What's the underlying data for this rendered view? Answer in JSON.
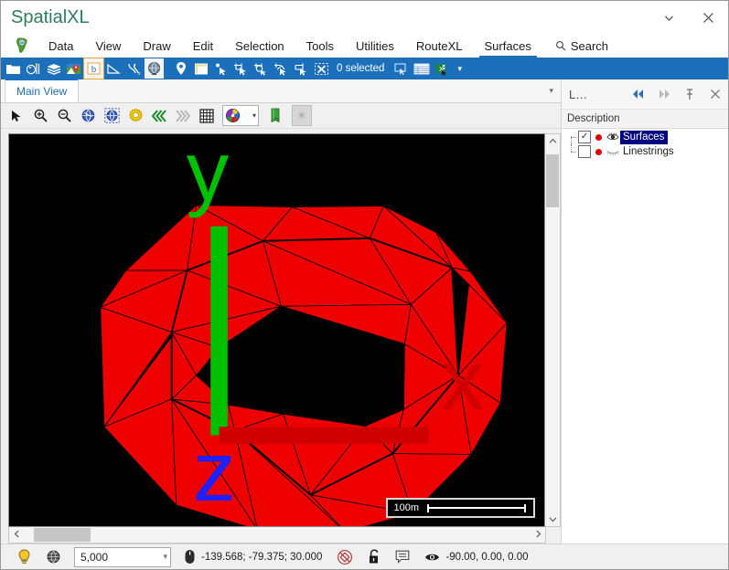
{
  "window": {
    "title": "SpatialXL",
    "minimize_label": "▾",
    "close_label": "✕"
  },
  "menu": {
    "logo_icon": "africa-logo-icon",
    "items": [
      {
        "label": "Data",
        "active": false
      },
      {
        "label": "View",
        "active": false
      },
      {
        "label": "Draw",
        "active": false
      },
      {
        "label": "Edit",
        "active": false
      },
      {
        "label": "Selection",
        "active": false
      },
      {
        "label": "Tools",
        "active": false
      },
      {
        "label": "Utilities",
        "active": false
      },
      {
        "label": "RouteXL",
        "active": false
      },
      {
        "label": "Surfaces",
        "active": true
      }
    ],
    "search_label": "Search",
    "search_icon": "search-icon"
  },
  "toolbar": {
    "selected_count_label": "0 selected",
    "icons": [
      "open-folder-icon",
      "palette-tools-icon",
      "layers-stack-icon",
      "map-pin-image-icon",
      "basemap-icon",
      "measure-angle-icon",
      "coordinate-tool-icon",
      "globe-icon",
      "location-pin-icon",
      "note-window-icon",
      "select-point-icon",
      "select-rectangle-icon",
      "select-circle-icon",
      "select-lasso-icon",
      "select-polygon-icon",
      "clear-selection-icon",
      "selection-window-icon",
      "attribute-table-icon",
      "export-excel-icon"
    ],
    "overflow_caret": "▾"
  },
  "view": {
    "tab_label": "Main View",
    "tabstrip_caret": "▾",
    "tools": [
      "pointer-arrow-icon",
      "zoom-in-icon",
      "zoom-out-icon",
      "globe-zoom-extents-icon",
      "globe-zoom-selection-icon",
      "settings-gear-icon",
      "rewind-previous-icon",
      "forward-next-icon",
      "grid-icon",
      "color-palette-icon",
      "green-flag-icon",
      "snapshot-icon"
    ],
    "palette_caret": "▾",
    "disabled_btn_label": "✳",
    "scale_bar": {
      "label": "100m"
    },
    "axes": {
      "x_label": "x",
      "y_label": "y",
      "z_label": "z",
      "x_color": "#d00000",
      "y_color": "#00c000",
      "z_color": "#2020ff"
    },
    "surface_color": "#ee0000",
    "background_color": "#000000",
    "scroll": {
      "up_arrow": "⌃",
      "down_arrow": "⌄",
      "left_arrow": "❮",
      "right_arrow": "❯"
    }
  },
  "layers_panel": {
    "title": "L...",
    "back_label": "◀◀",
    "forward_label": "▶▶",
    "pin_label": "⚲",
    "close_label": "✕",
    "column_header": "Description",
    "rows": [
      {
        "label": "Surfaces",
        "checked": true,
        "selected": true,
        "visible": true,
        "swatch_color": "#e00000"
      },
      {
        "label": "Linestrings",
        "checked": false,
        "selected": false,
        "visible": false,
        "swatch_color": "#e00000"
      }
    ]
  },
  "statusbar": {
    "lightbulb_icon": "lightbulb-icon",
    "globe_icon": "globe-status-icon",
    "scale_value": "5,000",
    "scale_caret": "▾",
    "mouse_icon": "mouse-icon",
    "coordinates": "-139.568; -79.375; 30.000",
    "snap_icon": "snap-disabled-icon",
    "lock_icon": "unlocked-padlock-icon",
    "annotation_icon": "annotation-icon",
    "eye_icon": "eye-icon",
    "view_angles": "-90.00, 0.00, 0.00"
  }
}
